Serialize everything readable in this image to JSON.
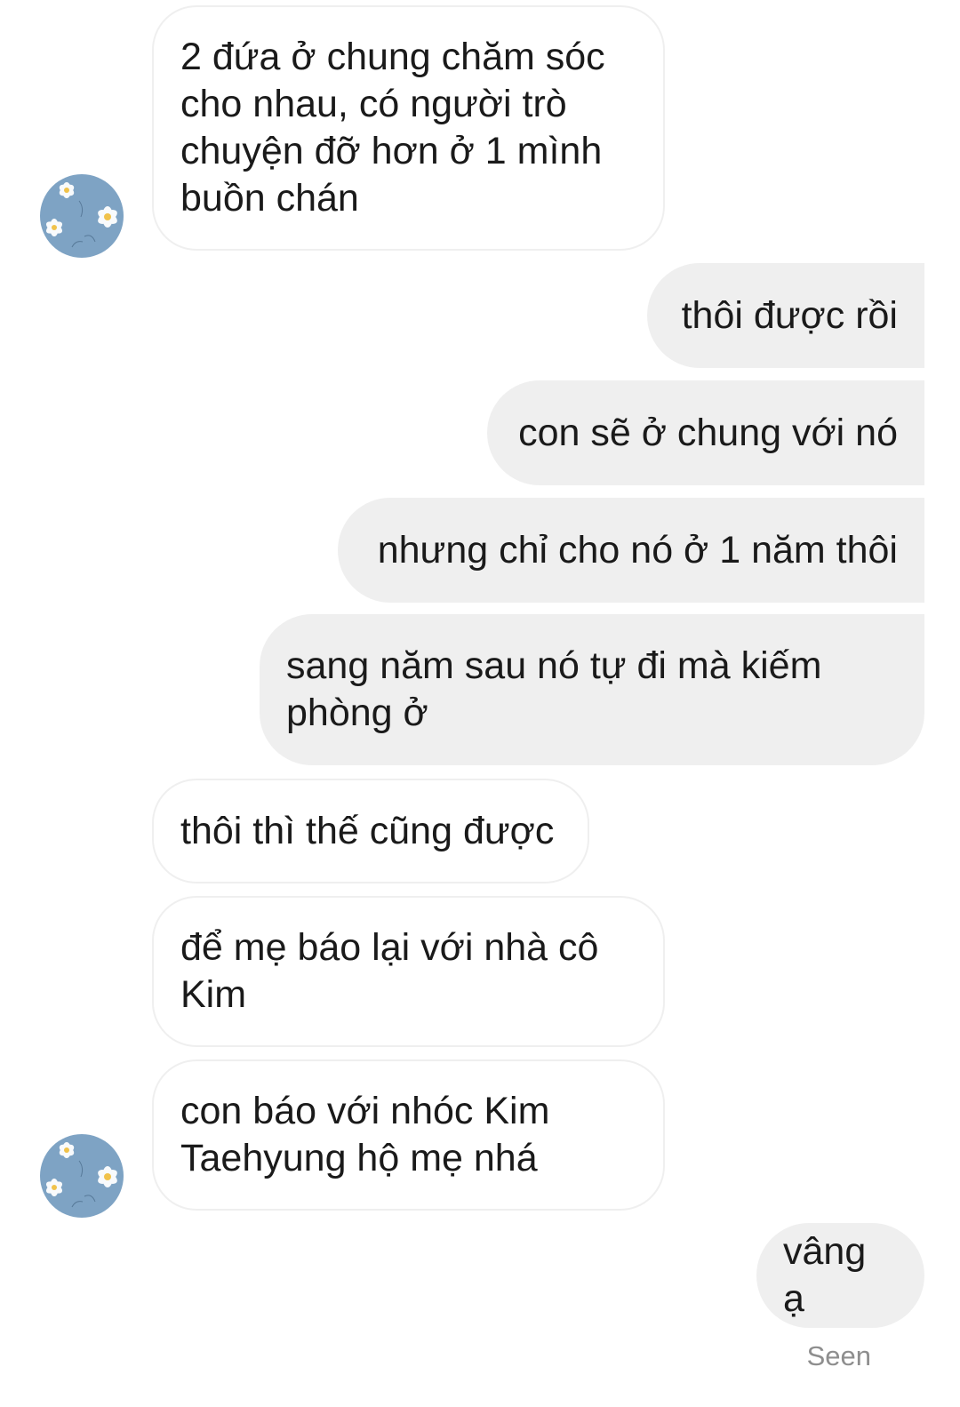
{
  "conversation": {
    "messages": [
      {
        "sender": "contact",
        "text": "2 đứa ở chung chăm sóc cho nhau, có người trò chuyện đỡ hơn ở 1 mình buồn chán"
      },
      {
        "sender": "me",
        "text": "thôi được rồi"
      },
      {
        "sender": "me",
        "text": "con sẽ ở chung với nó"
      },
      {
        "sender": "me",
        "text": "nhưng chỉ cho nó ở 1 năm thôi"
      },
      {
        "sender": "me",
        "text": "sang năm sau nó tự đi mà kiếm phòng ở"
      },
      {
        "sender": "contact",
        "text": "thôi thì thế cũng được"
      },
      {
        "sender": "contact",
        "text": "để mẹ báo lại với nhà cô Kim"
      },
      {
        "sender": "contact",
        "text": "con báo với nhóc Kim Taehyung hộ mẹ nhá"
      },
      {
        "sender": "me",
        "text": "vâng ạ"
      }
    ],
    "status": "Seen"
  },
  "avatar": {
    "icon": "floral-avatar-icon",
    "background_color": "#7ea3c4"
  },
  "colors": {
    "outgoing_bubble": "#efefef",
    "incoming_border": "#efefef",
    "text": "#1a1a1a",
    "status_text": "#8e8e8e"
  }
}
